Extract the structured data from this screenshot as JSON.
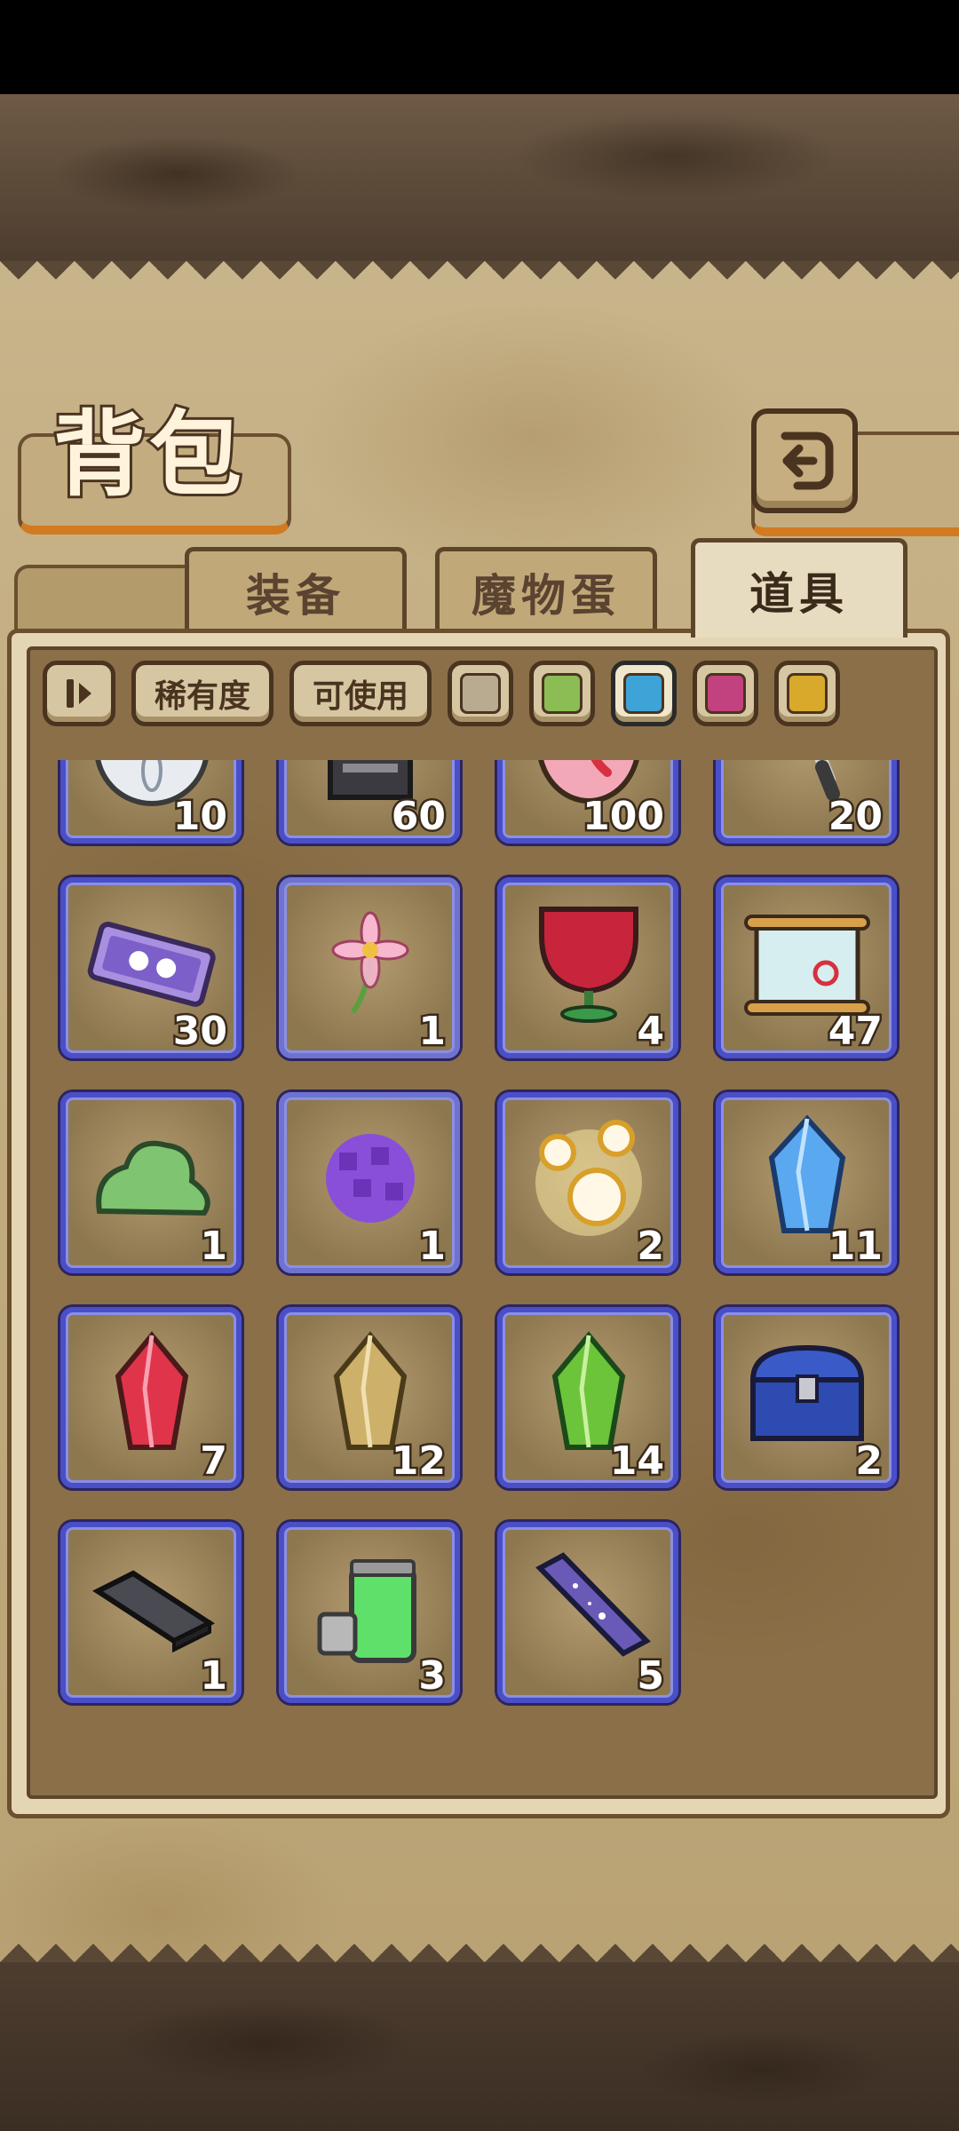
{
  "header": {
    "title": "背包"
  },
  "tabs": [
    {
      "label": "装备",
      "active": false
    },
    {
      "label": "魔物蛋",
      "active": false
    },
    {
      "label": "道具",
      "active": true
    }
  ],
  "filters": {
    "rarity_label": "稀有度",
    "usable_label": "可使用",
    "colors": [
      "#b8ab8f",
      "#8bbd54",
      "#3ea3d6",
      "#c2417f",
      "#d8a92a"
    ],
    "selected_color_index": 2
  },
  "items": [
    {
      "icon": "silver-flower-coin-icon",
      "count": "10"
    },
    {
      "icon": "sd-card-icon",
      "count": "60"
    },
    {
      "icon": "pink-candy-icon",
      "count": "100"
    },
    {
      "icon": "scroll-rod-icon",
      "count": "20"
    },
    {
      "icon": "purple-ticket-icon",
      "count": "30"
    },
    {
      "icon": "pink-flower-icon",
      "count": "1"
    },
    {
      "icon": "red-potion-goblet-icon",
      "count": "4"
    },
    {
      "icon": "treasure-map-scroll-icon",
      "count": "47"
    },
    {
      "icon": "green-slime-icon",
      "count": "1"
    },
    {
      "icon": "purple-berry-icon",
      "count": "1"
    },
    {
      "icon": "golden-bubbles-icon",
      "count": "2"
    },
    {
      "icon": "blue-crystal-icon",
      "count": "11"
    },
    {
      "icon": "red-crystal-icon",
      "count": "7"
    },
    {
      "icon": "gold-crystal-icon",
      "count": "12"
    },
    {
      "icon": "green-crystal-icon",
      "count": "14"
    },
    {
      "icon": "blue-treasure-chest-icon",
      "count": "2"
    },
    {
      "icon": "black-bar-icon",
      "count": "1"
    },
    {
      "icon": "green-battery-icon",
      "count": "3"
    },
    {
      "icon": "starry-bar-icon",
      "count": "5"
    }
  ]
}
